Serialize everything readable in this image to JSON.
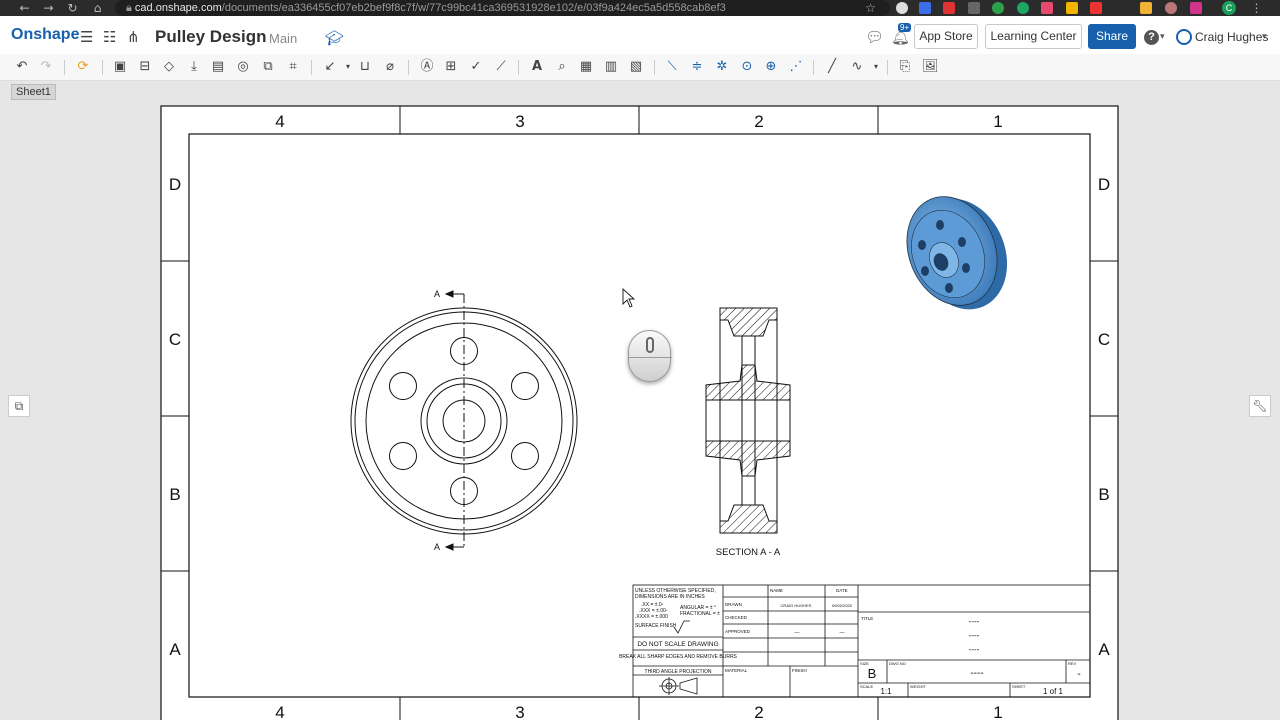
{
  "browser": {
    "url_host": "cad.onshape.com",
    "url_path": "/documents/ea336455cf07eb2bef9f8c7f/w/77c99bc41ca369531928e102/e/03f9a424ec5a5d558cab8ef3",
    "nav_icons": [
      "back-icon",
      "forward-icon",
      "reload-icon",
      "home-icon"
    ],
    "profile_initial": "C"
  },
  "app": {
    "logo": "Onshape",
    "document_title": "Pulley Design",
    "branch": "Main",
    "notification_badge": "9+",
    "buttons": {
      "app_store": "App Store",
      "learning_center": "Learning Center",
      "share": "Share"
    },
    "help_icon": "?",
    "user_name": "Craig Hughes",
    "accent_color": "#1760ae"
  },
  "sheet": {
    "tab_label": "Sheet1"
  },
  "drawing": {
    "col_labels": [
      "4",
      "3",
      "2",
      "1"
    ],
    "row_labels": [
      "D",
      "C",
      "B",
      "A"
    ],
    "cutting_plane_label": "A",
    "section_caption": "SECTION A - A",
    "title_block": {
      "notes": [
        "UNLESS OTHERWISE SPECIFIED,",
        "DIMENSIONS ARE IN INCHES",
        ".XX = ±.0-",
        ".XXX = ±.00-",
        ".XXXX = ±.000",
        "ANGULAR = ± °",
        "FRACTIONAL = ±",
        "SURFACE FINISH"
      ],
      "do_not_scale": "DO NOT SCALE DRAWING",
      "break_edges": "BREAK ALL SHARP EDGES AND REMOVE BURRS",
      "projection": "THIRD ANGLE PROJECTION",
      "labels": {
        "name": "NAME",
        "date": "DATE",
        "drawn": "DRAWN",
        "checked": "CHECKED",
        "approved": "APPROVED",
        "material": "MATERIAL",
        "finish": "FINISH",
        "title": "TITLE",
        "size": "SIZE",
        "dwg_no": "DWG NO",
        "rev": "REV",
        "scale": "SCALE",
        "weight": "WEIGHT",
        "sheet": "SHEET"
      },
      "drawn_name": "CRAIG HUGHES",
      "drawn_date": "09/02/2020",
      "approved_name": "—",
      "approved_date": "—",
      "title_lines": [
        "----",
        "----",
        "----"
      ],
      "size_value": "B",
      "dwg_no_value": "----",
      "rev_value": "-",
      "scale_value": "1:1",
      "sheet_value": "1 of 1"
    }
  }
}
